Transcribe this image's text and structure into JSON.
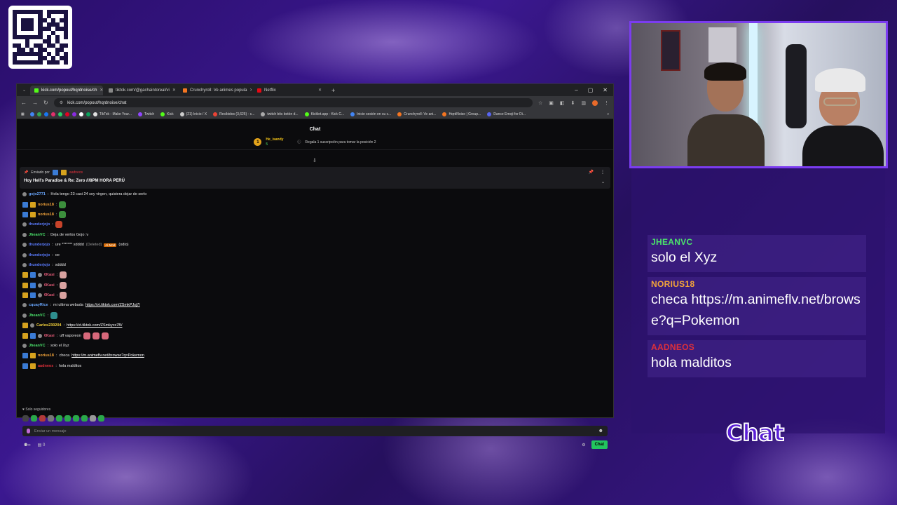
{
  "browser": {
    "tabs": [
      {
        "label": "kick.com/popout/hqrdnoise/ch",
        "active": true,
        "favicon_color": "#53fc18"
      },
      {
        "label": "tiktok.com/@gachaintoreal/vi",
        "active": false,
        "favicon_color": "#888888"
      },
      {
        "label": "Crunchyroll: Ve animes popula",
        "active": false,
        "favicon_color": "#f47521"
      },
      {
        "label": "Netflix",
        "active": false,
        "favicon_color": "#e50914"
      }
    ],
    "url": "kick.com/popout/hqrdnoise/chat",
    "bookmarks": [
      {
        "label": "TikTok - Make Your...",
        "color": "#e0e0e0"
      },
      {
        "label": "Twitch",
        "color": "#9146ff"
      },
      {
        "label": "Kick",
        "color": "#53fc18"
      },
      {
        "label": "(21) Inicio / X",
        "color": "#cccccc"
      },
      {
        "label": "Recibidos (3,626) - c...",
        "color": "#ea4335"
      },
      {
        "label": "twitch bits botón d...",
        "color": "#aaaaaa"
      },
      {
        "label": "Kicklet.app - Kick C...",
        "color": "#53fc18"
      },
      {
        "label": "Inicie sesión en su c...",
        "color": "#4285f4"
      },
      {
        "label": "Crunchyroll: Ve ani...",
        "color": "#f47521"
      },
      {
        "label": "HqrdNoise | Group...",
        "color": "#f47521"
      },
      {
        "label": "Dance Emoji for Di...",
        "color": "#5865f2"
      }
    ]
  },
  "chat": {
    "title": "Chat",
    "gift": {
      "user": "He_isandy",
      "count": "5",
      "text": "Regala 1 suscripción para tomar la posición 2"
    },
    "pinned": {
      "sent_by_label": "Enviado por",
      "sender": "aadneos",
      "text": "Hoy Hell's Paradise & Re: Zero ///8PM HORA PERÚ"
    },
    "messages": [
      {
        "user": "gojo2771",
        "color": "#6aa8ff",
        "text": "Hola tengo 23 casi 24 soy virgen, quisiera dejar de serlo",
        "badges": [
          "dot"
        ]
      },
      {
        "user": "norius18",
        "color": "#f2a33a",
        "text": "",
        "badges": [
          "blue",
          "gold"
        ],
        "emote": "#3c8f3c"
      },
      {
        "user": "norius18",
        "color": "#f2a33a",
        "text": "",
        "badges": [
          "blue",
          "gold"
        ],
        "emote": "#3c8f3c"
      },
      {
        "user": "thunderjojo",
        "color": "#5b7cff",
        "text": "",
        "badges": [
          "dot"
        ],
        "emote": "#c7432a"
      },
      {
        "user": "JheanVC",
        "color": "#4be36b",
        "text": "Deja de verlos Gojo :v",
        "badges": [
          "dot"
        ]
      },
      {
        "user": "thunderjojo",
        "color": "#5b7cff",
        "text": "ure ******* xdddd",
        "deleted": "(Deleted)",
        "tag": "Al Mod",
        "extra": "(odio)",
        "badges": [
          "dot"
        ]
      },
      {
        "user": "thunderjojo",
        "color": "#5b7cff",
        "text": "oe",
        "badges": [
          "dot"
        ]
      },
      {
        "user": "thunderjojo",
        "color": "#5b7cff",
        "text": "xdddd",
        "badges": [
          "dot"
        ]
      },
      {
        "user": "0Kasi",
        "color": "#e85d7a",
        "text": "",
        "badges": [
          "gold",
          "blue",
          "dot"
        ],
        "emote": "#d9a2a0"
      },
      {
        "user": "0Kasi",
        "color": "#e85d7a",
        "text": "",
        "badges": [
          "gold",
          "blue",
          "dot"
        ],
        "emote": "#d9a2a0"
      },
      {
        "user": "0Kasi",
        "color": "#e85d7a",
        "text": "",
        "badges": [
          "gold",
          "blue",
          "dot"
        ],
        "emote": "#d9a2a0"
      },
      {
        "user": "cquayRice",
        "color": "#6aa8ff",
        "text": "mi ultima webada ",
        "link": "https://vt.tiktok.com/ZSmkPJsj7/",
        "badges": [
          "dot"
        ]
      },
      {
        "user": "JheanVC",
        "color": "#4be36b",
        "text": "",
        "badges": [
          "dot"
        ],
        "emote": "#2f8f8f"
      },
      {
        "user": "Carlos230204",
        "color": "#f5d33b",
        "text": "",
        "link": "https://vt.tiktok.com/ZSmkycx7B/",
        "badges": [
          "gold",
          "dot"
        ]
      },
      {
        "user": "0Kasi",
        "color": "#e85d7a",
        "text": "uff vaporeon",
        "badges": [
          "gold",
          "blue",
          "dot"
        ],
        "emote": "#d7687a"
      },
      {
        "user": "JheanVC",
        "color": "#4be36b",
        "text": "solo el Xyz",
        "badges": [
          "dot"
        ]
      },
      {
        "user": "norius18",
        "color": "#f2a33a",
        "text": "checa ",
        "link": "https://m.animeflv.net/browse?q=Pokemon",
        "badges": [
          "blue",
          "gold"
        ]
      },
      {
        "user": "aadneos",
        "color": "#e0303a",
        "text": "hola malditos",
        "badges": [
          "blue",
          "gold"
        ]
      }
    ],
    "followers_only": "Solo seguidores",
    "input_placeholder": "Enviar un mensaje",
    "viewer_count": "0",
    "send_label": "Chat"
  },
  "overlay": {
    "messages": [
      {
        "user": "JHEANVC",
        "color": "#4be36b",
        "text": "solo el Xyz"
      },
      {
        "user": "NORIUS18",
        "color": "#f2a33a",
        "text": "checa https://m.animeflv.net/browse?q=Pokemon"
      },
      {
        "user": "AADNEOS",
        "color": "#e0303a",
        "text": "hola malditos"
      }
    ],
    "title": "Chat"
  }
}
